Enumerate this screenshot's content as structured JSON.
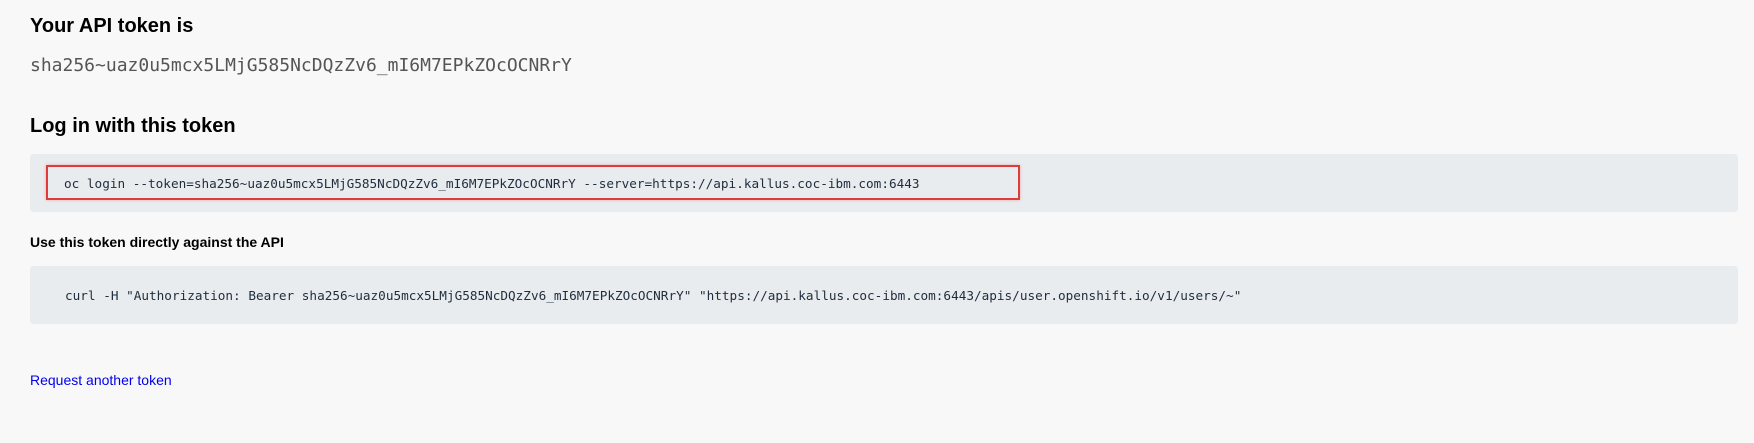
{
  "api_token": {
    "heading": "Your API token is",
    "value": "sha256~uaz0u5mcx5LMjG585NcDQzZv6_mI6M7EPkZOcOCNRrY"
  },
  "login": {
    "heading": "Log in with this token",
    "command": "oc login --token=sha256~uaz0u5mcx5LMjG585NcDQzZv6_mI6M7EPkZOcOCNRrY --server=https://api.kallus.coc-ibm.com:6443"
  },
  "api_usage": {
    "heading": "Use this token directly against the API",
    "command": "curl -H \"Authorization: Bearer sha256~uaz0u5mcx5LMjG585NcDQzZv6_mI6M7EPkZOcOCNRrY\" \"https://api.kallus.coc-ibm.com:6443/apis/user.openshift.io/v1/users/~\""
  },
  "links": {
    "request_another": "Request another token"
  },
  "colors": {
    "background": "#f8f8f8",
    "code_background": "#e9ecef",
    "highlight_border": "#e03a3a",
    "link": "#0000ee"
  }
}
